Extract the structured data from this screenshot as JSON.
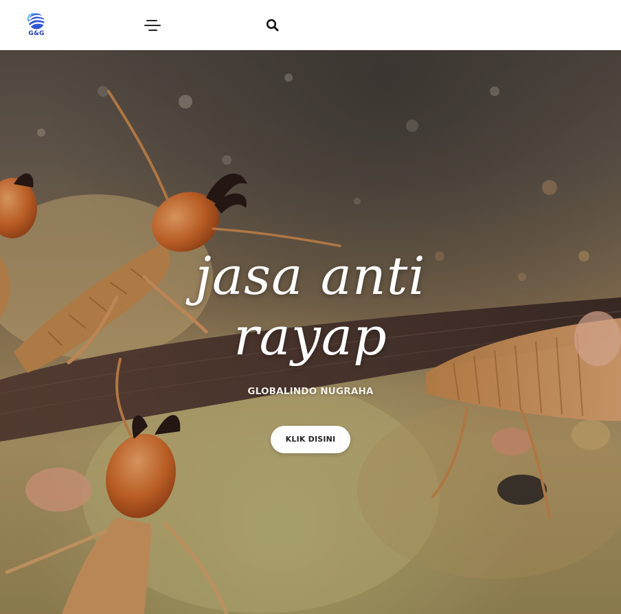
{
  "header": {
    "logo_text": "G&G",
    "menu_icon": "hamburger-menu-icon",
    "search_icon": "search-icon"
  },
  "hero": {
    "title_line1": "jasa anti",
    "title_line2": "rayap",
    "subtitle": "GLOBALINDO NUGRAHA",
    "cta_label": "KLIK DISINI",
    "background": "termite-photo"
  },
  "colors": {
    "logo_blue": "#1f3fbf",
    "topbar_bg": "#ffffff",
    "cta_bg": "#ffffff",
    "hero_text": "#ffffff"
  }
}
